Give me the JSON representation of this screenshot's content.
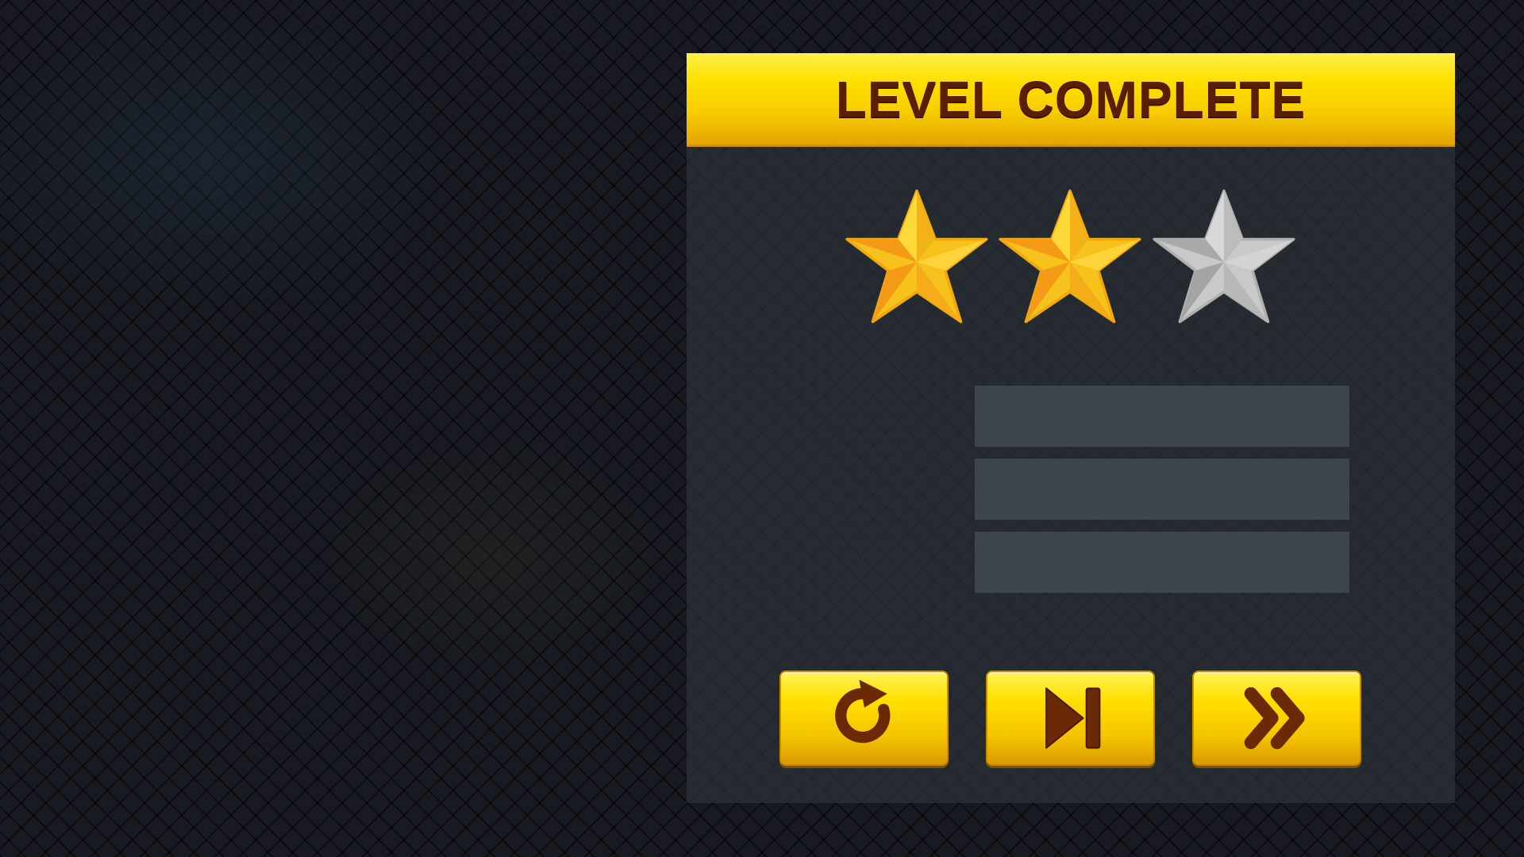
{
  "dialog": {
    "title": "LEVEL COMPLETE",
    "rating": {
      "earned": 2,
      "total": 3
    },
    "stat_rows": [
      "",
      "",
      ""
    ],
    "buttons": [
      {
        "icon": "replay-icon"
      },
      {
        "icon": "next-level-icon"
      },
      {
        "icon": "fast-forward-icon"
      }
    ]
  },
  "colors": {
    "accent_yellow": "#ffe000",
    "title_brown": "#5a1e02",
    "star_gold": "#f9c51f",
    "star_silver": "#c8c8c8",
    "panel": "#262b31",
    "stat_row": "#3e454d"
  }
}
